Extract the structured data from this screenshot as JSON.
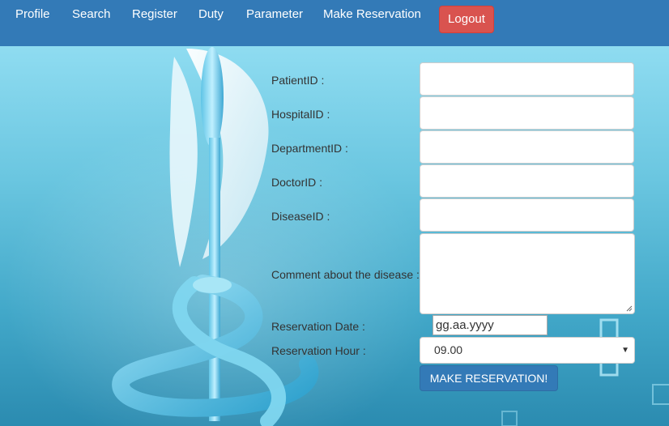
{
  "nav": {
    "items": [
      "Profile",
      "Search",
      "Register",
      "Duty",
      "Parameter",
      "Make Reservation"
    ],
    "logout_label": "Logout"
  },
  "form": {
    "labels": {
      "patient_id": "PatientID :",
      "hospital_id": "HospitalID :",
      "department_id": "DepartmentID :",
      "doctor_id": "DoctorID :",
      "disease_id": "DiseaseID :",
      "comment": "Comment about the disease :",
      "reservation_date": "Reservation Date :",
      "reservation_hour": "Reservation Hour :"
    },
    "values": {
      "patient_id": "",
      "hospital_id": "",
      "department_id": "",
      "doctor_id": "",
      "disease_id": "",
      "comment": ""
    },
    "date_placeholder": "gg.aa.yyyy",
    "hour_selected": "09.00",
    "submit_label": "MAKE RESERVATION!"
  },
  "colors": {
    "navbar": "#337ab7",
    "logout": "#d9534f",
    "submit": "#337ab7"
  },
  "icons": {
    "select_arrow": "chevron-down-icon",
    "resize": "resize-grip-icon"
  }
}
